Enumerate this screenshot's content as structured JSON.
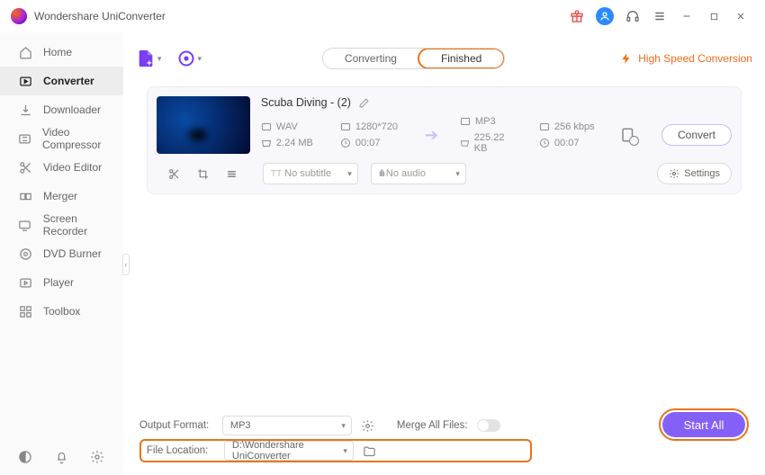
{
  "app": {
    "title": "Wondershare UniConverter"
  },
  "sidebar": {
    "items": [
      {
        "label": "Home"
      },
      {
        "label": "Converter"
      },
      {
        "label": "Downloader"
      },
      {
        "label": "Video Compressor"
      },
      {
        "label": "Video Editor"
      },
      {
        "label": "Merger"
      },
      {
        "label": "Screen Recorder"
      },
      {
        "label": "DVD Burner"
      },
      {
        "label": "Player"
      },
      {
        "label": "Toolbox"
      }
    ]
  },
  "tabs": {
    "converting": "Converting",
    "finished": "Finished"
  },
  "top": {
    "hsc": "High Speed Conversion"
  },
  "item": {
    "title": "Scuba Diving - (2)",
    "src_fmt": "WAV",
    "src_res": "1280*720",
    "src_size": "2.24 MB",
    "src_dur": "00:07",
    "dst_fmt": "MP3",
    "dst_br": "256 kbps",
    "dst_size": "225.22 KB",
    "dst_dur": "00:07",
    "subtitle": "No subtitle",
    "audio": "No audio",
    "settings": "Settings",
    "convert": "Convert"
  },
  "bottom": {
    "out_label": "Output Format:",
    "out_value": "MP3",
    "merge_label": "Merge All Files:",
    "loc_label": "File Location:",
    "loc_value": "D:\\Wondershare UniConverter",
    "start": "Start All"
  }
}
